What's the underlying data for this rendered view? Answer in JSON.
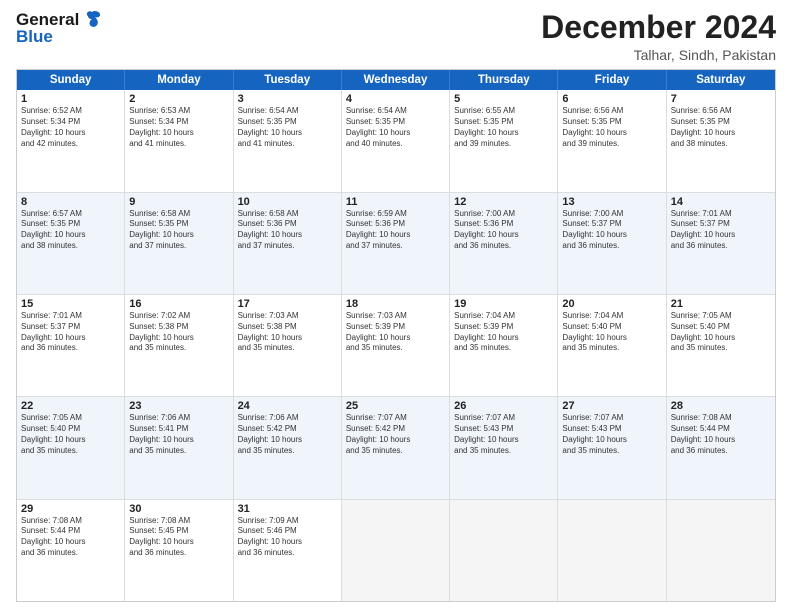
{
  "logo": {
    "line1": "General",
    "line2": "Blue"
  },
  "title": "December 2024",
  "subtitle": "Talhar, Sindh, Pakistan",
  "headers": [
    "Sunday",
    "Monday",
    "Tuesday",
    "Wednesday",
    "Thursday",
    "Friday",
    "Saturday"
  ],
  "rows": [
    [
      {
        "day": "1",
        "lines": [
          "Sunrise: 6:52 AM",
          "Sunset: 5:34 PM",
          "Daylight: 10 hours",
          "and 42 minutes."
        ]
      },
      {
        "day": "2",
        "lines": [
          "Sunrise: 6:53 AM",
          "Sunset: 5:34 PM",
          "Daylight: 10 hours",
          "and 41 minutes."
        ]
      },
      {
        "day": "3",
        "lines": [
          "Sunrise: 6:54 AM",
          "Sunset: 5:35 PM",
          "Daylight: 10 hours",
          "and 41 minutes."
        ]
      },
      {
        "day": "4",
        "lines": [
          "Sunrise: 6:54 AM",
          "Sunset: 5:35 PM",
          "Daylight: 10 hours",
          "and 40 minutes."
        ]
      },
      {
        "day": "5",
        "lines": [
          "Sunrise: 6:55 AM",
          "Sunset: 5:35 PM",
          "Daylight: 10 hours",
          "and 39 minutes."
        ]
      },
      {
        "day": "6",
        "lines": [
          "Sunrise: 6:56 AM",
          "Sunset: 5:35 PM",
          "Daylight: 10 hours",
          "and 39 minutes."
        ]
      },
      {
        "day": "7",
        "lines": [
          "Sunrise: 6:56 AM",
          "Sunset: 5:35 PM",
          "Daylight: 10 hours",
          "and 38 minutes."
        ]
      }
    ],
    [
      {
        "day": "8",
        "lines": [
          "Sunrise: 6:57 AM",
          "Sunset: 5:35 PM",
          "Daylight: 10 hours",
          "and 38 minutes."
        ]
      },
      {
        "day": "9",
        "lines": [
          "Sunrise: 6:58 AM",
          "Sunset: 5:35 PM",
          "Daylight: 10 hours",
          "and 37 minutes."
        ]
      },
      {
        "day": "10",
        "lines": [
          "Sunrise: 6:58 AM",
          "Sunset: 5:36 PM",
          "Daylight: 10 hours",
          "and 37 minutes."
        ]
      },
      {
        "day": "11",
        "lines": [
          "Sunrise: 6:59 AM",
          "Sunset: 5:36 PM",
          "Daylight: 10 hours",
          "and 37 minutes."
        ]
      },
      {
        "day": "12",
        "lines": [
          "Sunrise: 7:00 AM",
          "Sunset: 5:36 PM",
          "Daylight: 10 hours",
          "and 36 minutes."
        ]
      },
      {
        "day": "13",
        "lines": [
          "Sunrise: 7:00 AM",
          "Sunset: 5:37 PM",
          "Daylight: 10 hours",
          "and 36 minutes."
        ]
      },
      {
        "day": "14",
        "lines": [
          "Sunrise: 7:01 AM",
          "Sunset: 5:37 PM",
          "Daylight: 10 hours",
          "and 36 minutes."
        ]
      }
    ],
    [
      {
        "day": "15",
        "lines": [
          "Sunrise: 7:01 AM",
          "Sunset: 5:37 PM",
          "Daylight: 10 hours",
          "and 36 minutes."
        ]
      },
      {
        "day": "16",
        "lines": [
          "Sunrise: 7:02 AM",
          "Sunset: 5:38 PM",
          "Daylight: 10 hours",
          "and 35 minutes."
        ]
      },
      {
        "day": "17",
        "lines": [
          "Sunrise: 7:03 AM",
          "Sunset: 5:38 PM",
          "Daylight: 10 hours",
          "and 35 minutes."
        ]
      },
      {
        "day": "18",
        "lines": [
          "Sunrise: 7:03 AM",
          "Sunset: 5:39 PM",
          "Daylight: 10 hours",
          "and 35 minutes."
        ]
      },
      {
        "day": "19",
        "lines": [
          "Sunrise: 7:04 AM",
          "Sunset: 5:39 PM",
          "Daylight: 10 hours",
          "and 35 minutes."
        ]
      },
      {
        "day": "20",
        "lines": [
          "Sunrise: 7:04 AM",
          "Sunset: 5:40 PM",
          "Daylight: 10 hours",
          "and 35 minutes."
        ]
      },
      {
        "day": "21",
        "lines": [
          "Sunrise: 7:05 AM",
          "Sunset: 5:40 PM",
          "Daylight: 10 hours",
          "and 35 minutes."
        ]
      }
    ],
    [
      {
        "day": "22",
        "lines": [
          "Sunrise: 7:05 AM",
          "Sunset: 5:40 PM",
          "Daylight: 10 hours",
          "and 35 minutes."
        ]
      },
      {
        "day": "23",
        "lines": [
          "Sunrise: 7:06 AM",
          "Sunset: 5:41 PM",
          "Daylight: 10 hours",
          "and 35 minutes."
        ]
      },
      {
        "day": "24",
        "lines": [
          "Sunrise: 7:06 AM",
          "Sunset: 5:42 PM",
          "Daylight: 10 hours",
          "and 35 minutes."
        ]
      },
      {
        "day": "25",
        "lines": [
          "Sunrise: 7:07 AM",
          "Sunset: 5:42 PM",
          "Daylight: 10 hours",
          "and 35 minutes."
        ]
      },
      {
        "day": "26",
        "lines": [
          "Sunrise: 7:07 AM",
          "Sunset: 5:43 PM",
          "Daylight: 10 hours",
          "and 35 minutes."
        ]
      },
      {
        "day": "27",
        "lines": [
          "Sunrise: 7:07 AM",
          "Sunset: 5:43 PM",
          "Daylight: 10 hours",
          "and 35 minutes."
        ]
      },
      {
        "day": "28",
        "lines": [
          "Sunrise: 7:08 AM",
          "Sunset: 5:44 PM",
          "Daylight: 10 hours",
          "and 36 minutes."
        ]
      }
    ],
    [
      {
        "day": "29",
        "lines": [
          "Sunrise: 7:08 AM",
          "Sunset: 5:44 PM",
          "Daylight: 10 hours",
          "and 36 minutes."
        ]
      },
      {
        "day": "30",
        "lines": [
          "Sunrise: 7:08 AM",
          "Sunset: 5:45 PM",
          "Daylight: 10 hours",
          "and 36 minutes."
        ]
      },
      {
        "day": "31",
        "lines": [
          "Sunrise: 7:09 AM",
          "Sunset: 5:46 PM",
          "Daylight: 10 hours",
          "and 36 minutes."
        ]
      },
      null,
      null,
      null,
      null
    ]
  ]
}
